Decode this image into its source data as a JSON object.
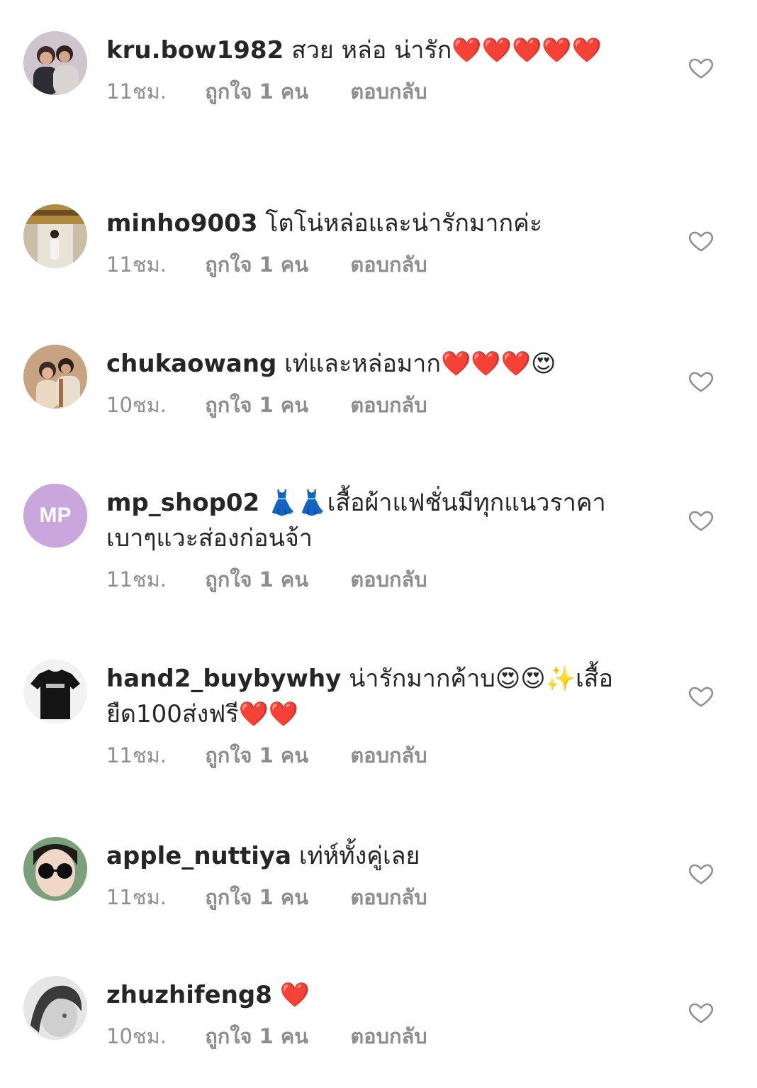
{
  "comments": [
    {
      "username": "kru.bow1982",
      "text": "สวย หล่อ น่ารัก❤️❤️❤️❤️❤️",
      "time": "11ชม.",
      "likes": "ถูกใจ 1 คน",
      "reply": "ตอบกลับ",
      "avatar": "couple-photo"
    },
    {
      "username": "minho9003",
      "text": "โตโน่หล่อและน่ารักมากค่ะ",
      "time": "11ชม.",
      "likes": "ถูกใจ 1 คน",
      "reply": "ตอบกลับ",
      "avatar": "person-at-temple"
    },
    {
      "username": "chukaowang",
      "text": "เท่และหล่อมาก❤️❤️❤️😍",
      "time": "10ชม.",
      "likes": "ถูกใจ 1 คน",
      "reply": "ตอบกลับ",
      "avatar": "vintage-couple-photo"
    },
    {
      "username": "mp_shop02",
      "text": "👗👗เสื้อผ้าแฟชั่นมีทุกแนวราคาเบาๆแวะส่องก่อนจ้า",
      "time": "11ชม.",
      "likes": "ถูกใจ 1 คน",
      "reply": "ตอบกลับ",
      "avatar": "mp-shop-logo",
      "logo_text": "MP"
    },
    {
      "username": "hand2_buybywhy",
      "text": "น่ารักมากค้าบ😍😍✨เสื้อยืด100ส่งฟรี❤️❤️",
      "time": "11ชม.",
      "likes": "ถูกใจ 1 คน",
      "reply": "ตอบกลับ",
      "avatar": "black-tshirt"
    },
    {
      "username": "apple_nuttiya",
      "text": "เท่ห์ทั้งคู่เลย",
      "time": "11ชม.",
      "likes": "ถูกใจ 1 คน",
      "reply": "ตอบกลับ",
      "avatar": "woman-sunglasses"
    },
    {
      "username": "zhuzhifeng8",
      "text": "❤️",
      "time": "10ชม.",
      "likes": "ถูกใจ 1 คน",
      "reply": "ตอบกลับ",
      "avatar": "grayscale-face"
    }
  ],
  "colors": {
    "text": "#262626",
    "meta": "#8e8e8e",
    "heart_outline": "#8e8e8e",
    "background": "#ffffff",
    "logo_bg": "#c9a6dc"
  },
  "icons": {
    "like": "heart-outline-icon"
  }
}
